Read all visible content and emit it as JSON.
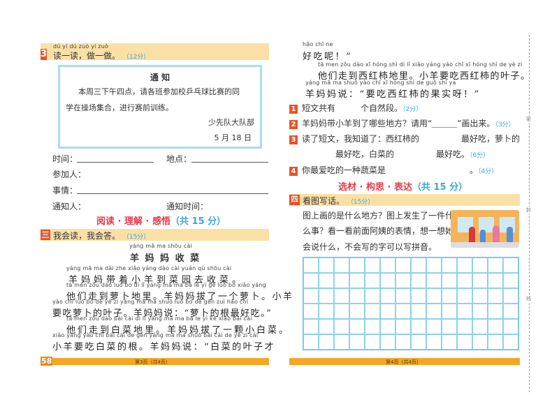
{
  "left_page": {
    "section3": {
      "number": "3",
      "pinyin": "dú yi dú   zuò yi zuò",
      "title": "读一读，做一做。",
      "score": "（12分）",
      "notice": {
        "title": "通 知",
        "body_line1": "本周三下午四点，请各班参加校乒乓球比赛的同",
        "body_line2": "学在操场集合，进行赛前训练。",
        "signature": "少先队大队部",
        "date": "5 月 18 日"
      },
      "fields": {
        "time": "时间：",
        "place": "地点：",
        "participants": "参加人：",
        "matter": "事情：",
        "notifier": "通知人：",
        "notice_time": "通知时间："
      }
    },
    "reading_heading": {
      "red": "阅读 · 理解 · 感悟",
      "blue": "（共 15 分）"
    },
    "section_san": {
      "number": "三",
      "title": "我会读，我会答。",
      "score": "（15分）",
      "story_title_pinyin": "yáng mā ma shōu cài",
      "story_title": "羊 妈 妈 收 菜",
      "lines": [
        {
          "py": "yáng mā ma dài zhe xiǎo yáng dào cài yuán qù shōu cài",
          "hz": "羊妈妈带着小羊到菜园去收菜。"
        },
        {
          "py": "tā men zǒu dào luó bo dì lǐ   yáng mā ma bá le yí gè luó bo   xiǎo yáng",
          "hz": "他们走到萝卜地里。羊妈妈拔了一个萝卜。小羊"
        },
        {
          "py": "yào chī luó bo de yè zi   yáng mā ma shuō   luó bo de gēn zuì hǎo chī",
          "hz": "要吃萝卜的叶子。羊妈妈说：“萝卜的根最好吃。”"
        },
        {
          "py": "tā men zǒu dào bái cài dì lǐ   yáng mā ma bá le yì kē xiǎo bái cài",
          "hz": "他们走到白菜地里。羊妈妈拔了一颗小白菜。"
        },
        {
          "py": "xiǎo yáng yào chī bái cài de gēn   yáng mā ma shuō bái cài de yè zi cái",
          "hz": "小羊要吃白菜的根。羊妈妈说：“白菜的叶子才"
        }
      ]
    },
    "page_number": "58",
    "footer": "第3页（共4页）"
  },
  "right_page": {
    "story_cont": [
      {
        "py": "hǎo chī ne",
        "hz": "好吃呢！”"
      },
      {
        "py": "tā men zǒu dào xī hóng shì dì lǐ   xiǎo yáng yào chī xī hóng shì de yè zi",
        "hz": "他们走到西红柿地里。小羊要吃西红柿的叶子。"
      },
      {
        "py": "yáng mā ma shuō   yào chī xī hóng shì de guǒ shí ya",
        "hz": "羊妈妈说：“要吃西红柿的果实呀！”"
      }
    ],
    "questions": [
      {
        "num": "1",
        "text": "短文共有　　　个自然段。",
        "score": "（2分）"
      },
      {
        "num": "2",
        "text": "羊妈妈带小羊到了哪些地方？请用“＿＿＿”画出来。",
        "score": "（3分）"
      },
      {
        "num": "3",
        "text": "读了短文，我知道了：西红柿的　　　　　最好吃，萝卜的",
        "text2": "　　　　最好吃，白菜的　　　　　最好吃。",
        "score": "（6分）"
      },
      {
        "num": "4",
        "text": "你最爱吃的一种蔬菜是　　　　　　　　　　。",
        "score": "（4分）"
      }
    ],
    "writing_heading": {
      "red": "选材 · 构思 · 表达",
      "blue": "（共 15 分）"
    },
    "section_si": {
      "number": "四",
      "title": "看图写话。",
      "score": "（15分）",
      "prompt_lines": [
        "图上画的是什么地方？图上发生了一件什",
        "么事？看一看前面阿姨的表情，想一想她",
        "会说什么，不会写的字可以写拼音。"
      ]
    },
    "grid": {
      "columns": 14,
      "rows": 6
    },
    "footer": "第4页（共4页）",
    "margin_labels": [
      "密",
      "封",
      "线"
    ]
  },
  "colors": {
    "accent_red": "#e8532a",
    "bar": "#fbe0a6",
    "footer": "#f5a623",
    "blue": "#3fa7d6"
  }
}
